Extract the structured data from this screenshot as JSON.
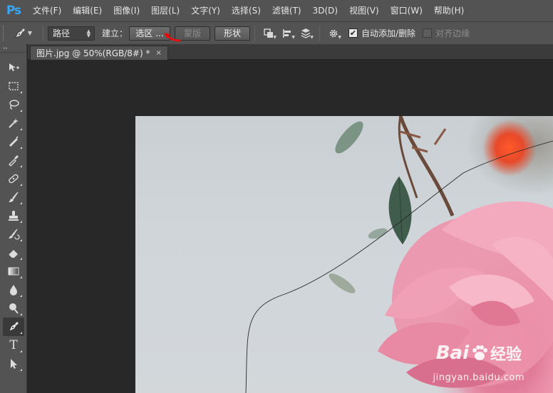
{
  "app": {
    "logo": "Ps"
  },
  "menu": [
    {
      "label": "文件(F)"
    },
    {
      "label": "编辑(E)"
    },
    {
      "label": "图像(I)"
    },
    {
      "label": "图层(L)"
    },
    {
      "label": "文字(Y)"
    },
    {
      "label": "选择(S)"
    },
    {
      "label": "滤镜(T)"
    },
    {
      "label": "3D(D)"
    },
    {
      "label": "视图(V)"
    },
    {
      "label": "窗口(W)"
    },
    {
      "label": "帮助(H)"
    }
  ],
  "options": {
    "mode_select": "路径",
    "build_label": "建立：",
    "selection_button": "选区 ...",
    "mask_button": "蒙版",
    "shape_button": "形状",
    "auto_add_delete": {
      "label": "自动添加/删除",
      "checked": true
    },
    "align_edges": {
      "label": "对齐边缘",
      "checked": false
    }
  },
  "document": {
    "tab_title": "图片.jpg @ 50%(RGB/8#) *",
    "close_glyph": "×"
  },
  "toolbar": {
    "collapse_glyph": "››",
    "type_tool_glyph": "T",
    "tools": [
      "move-tool",
      "marquee-tool",
      "lasso-tool",
      "magic-wand-tool",
      "crop-tool",
      "eyedropper-tool",
      "healing-brush-tool",
      "brush-tool",
      "clone-stamp-tool",
      "history-brush-tool",
      "eraser-tool",
      "gradient-tool",
      "blur-tool",
      "dodge-tool",
      "pen-tool",
      "type-tool",
      "path-selection-tool"
    ],
    "active_tool": "pen-tool"
  },
  "watermark": {
    "brand_left": "Bai",
    "brand_right": "经验",
    "url": "jingyan.baidu.com"
  },
  "colors": {
    "ps_blue": "#31a8ff",
    "panel": "#535353",
    "workspace": "#282828",
    "annotation_arrow": "#e01010"
  }
}
